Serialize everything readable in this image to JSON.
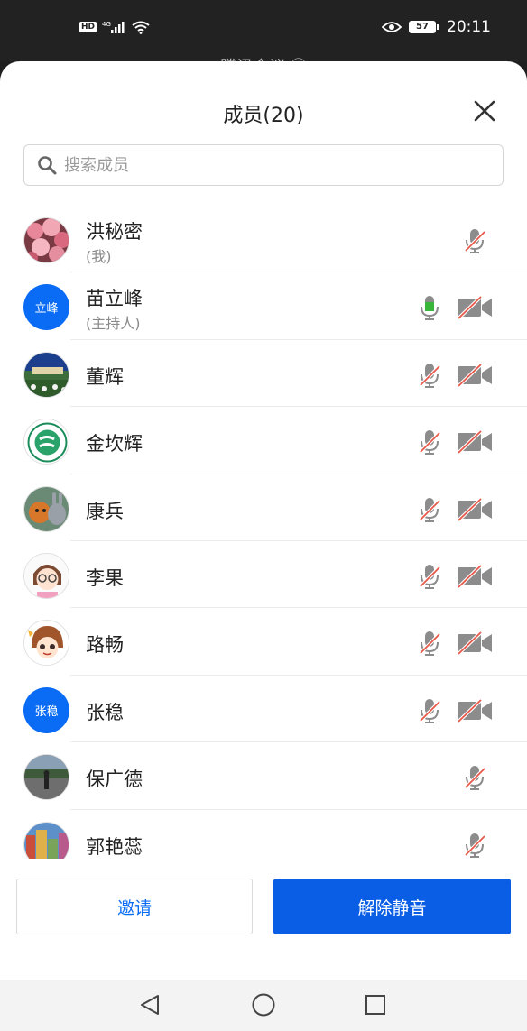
{
  "status_bar": {
    "hd_badge": "HD",
    "network": "4G",
    "battery_level": "57",
    "time": "20:11"
  },
  "background": {
    "title_behind": "腾讯会议 ⓘ"
  },
  "sheet": {
    "title": "成员(20)",
    "search_placeholder": "搜索成员"
  },
  "members": [
    {
      "name": "洪秘密",
      "role": "(我)",
      "avatar_type": "image",
      "avatar_theme": "pink-blossoms",
      "mic": "muted",
      "camera": "none"
    },
    {
      "name": "苗立峰",
      "role": "(主持人)",
      "avatar_type": "text",
      "avatar_text": "立峰",
      "mic": "active",
      "camera": "off"
    },
    {
      "name": "董辉",
      "role": "",
      "avatar_type": "image",
      "avatar_theme": "night-campus",
      "mic": "muted",
      "camera": "off"
    },
    {
      "name": "金坎辉",
      "role": "",
      "avatar_type": "image",
      "avatar_theme": "green-school-logo",
      "mic": "muted",
      "camera": "off"
    },
    {
      "name": "康兵",
      "role": "",
      "avatar_type": "image",
      "avatar_theme": "cartoon-fox-rabbit",
      "mic": "muted",
      "camera": "off"
    },
    {
      "name": "李果",
      "role": "",
      "avatar_type": "image",
      "avatar_theme": "cartoon-girl-glasses",
      "mic": "muted",
      "camera": "off"
    },
    {
      "name": "路畅",
      "role": "",
      "avatar_type": "image",
      "avatar_theme": "anime-girl",
      "mic": "muted",
      "camera": "off"
    },
    {
      "name": "张稳",
      "role": "",
      "avatar_type": "text",
      "avatar_text": "张稳",
      "mic": "muted",
      "camera": "off"
    },
    {
      "name": "保广德",
      "role": "",
      "avatar_type": "image",
      "avatar_theme": "street-photo",
      "mic": "muted",
      "camera": "none"
    },
    {
      "name": "郭艳蕊",
      "role": "",
      "avatar_type": "image",
      "avatar_theme": "colorful-buildings",
      "mic": "muted",
      "camera": "none"
    }
  ],
  "actions": {
    "invite_label": "邀请",
    "unmute_label": "解除静音"
  },
  "colors": {
    "accent": "#0a5ee6",
    "text_avatar": "#0a6cf5",
    "mic_active": "#38b63a",
    "muted_slash": "#e8584a",
    "icon_gray": "#8c8c8c"
  }
}
